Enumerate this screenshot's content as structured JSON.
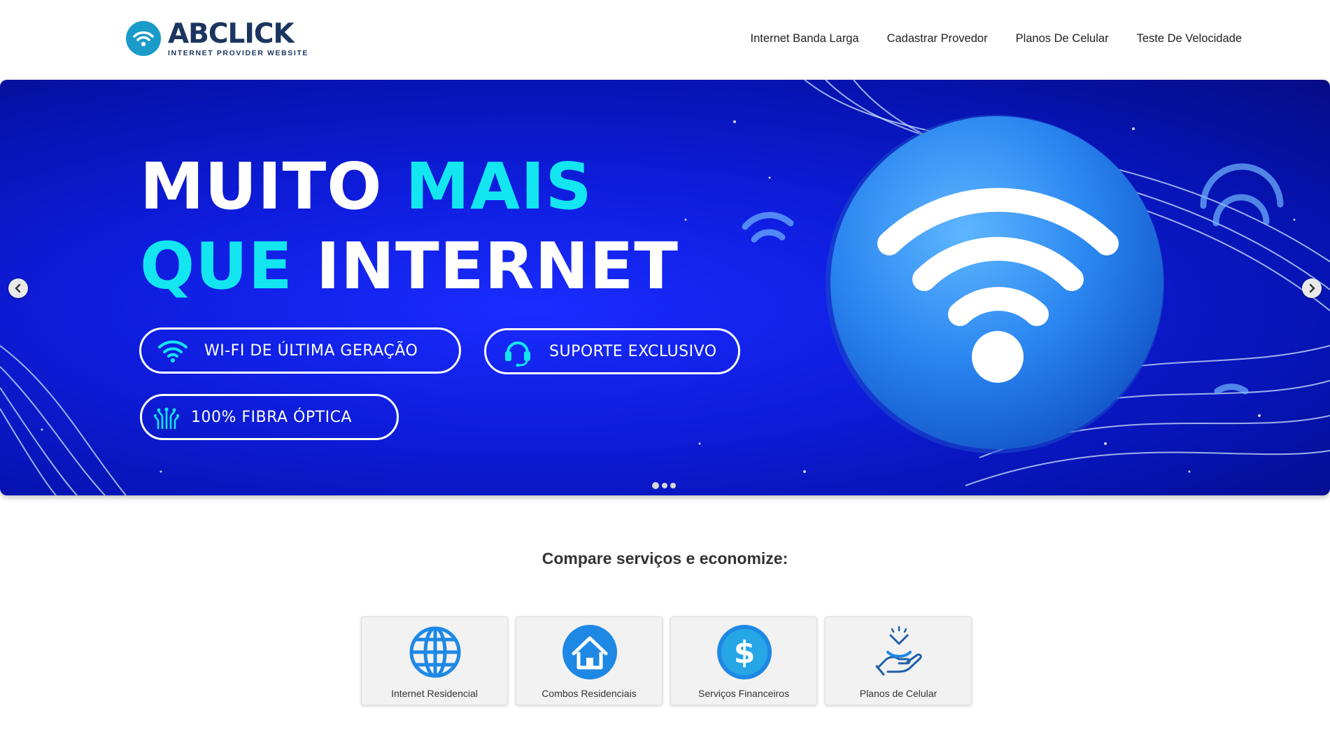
{
  "brand": {
    "name_part1": "AB",
    "name_part2": "CLICK",
    "tagline": "INTERNET PROVIDER WEBSITE",
    "accent_color": "#1a9bc9",
    "text_color": "#1b3560"
  },
  "nav": {
    "items": [
      {
        "label": "Internet Banda Larga"
      },
      {
        "label": "Cadastrar Provedor"
      },
      {
        "label": "Planos De Celular"
      },
      {
        "label": "Teste De Velocidade"
      }
    ]
  },
  "hero": {
    "line1_white": "MUITO ",
    "line1_cyan": "MAIS",
    "line2_cyan": "QUE ",
    "line2_white": "INTERNET",
    "features": [
      {
        "label": "WI-FI DE ÚLTIMA GERAÇÃO",
        "icon": "wifi-icon"
      },
      {
        "label": "SUPORTE EXCLUSIVO",
        "icon": "headset-icon"
      },
      {
        "label": "100% FIBRA ÓPTICA",
        "icon": "fiber-icon"
      }
    ],
    "slides_count": 3,
    "active_slide": 1,
    "cyan_color": "#13e6f0",
    "background_color": "#0f1ee0"
  },
  "compare": {
    "title": "Compare serviços e economize:",
    "cards": [
      {
        "label": "Internet Residencial",
        "icon": "globe-icon"
      },
      {
        "label": "Combos Residenciais",
        "icon": "house-icon"
      },
      {
        "label": "Serviços Financeiros",
        "icon": "dollar-icon"
      },
      {
        "label": "Planos de Celular",
        "icon": "hand-phone-icon"
      }
    ]
  }
}
